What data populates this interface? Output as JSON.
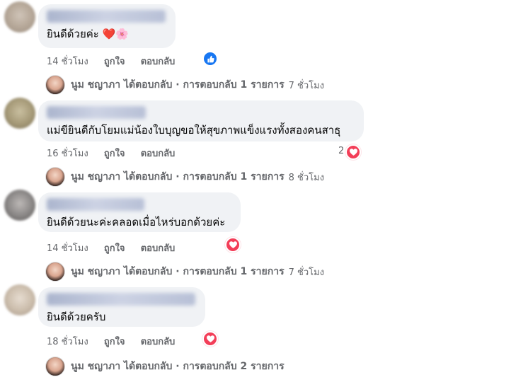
{
  "comments": [
    {
      "text": "ยินดีด้วยค่ะ ❤️🌸",
      "time": "14 ชั่วโมง",
      "like": "ถูกใจ",
      "reply": "ตอบกลับ",
      "reply_summary": {
        "name": "นูม ชญาภา",
        "text": "ได้ตอบกลับ · การตอบกลับ 1 รายการ",
        "time": "7 ชั่วโมง"
      }
    },
    {
      "text": "แม่ขียินดีกับโยมแม่น้องใบบุญขอให้สุขภาพแข็งแรงทั้งสองคนสาธุ",
      "time": "16 ชั่วโมง",
      "like": "ถูกใจ",
      "reply": "ตอบกลับ",
      "reaction_count": "2",
      "reply_summary": {
        "name": "นูม ชญาภา",
        "text": "ได้ตอบกลับ · การตอบกลับ 1 รายการ",
        "time": "8 ชั่วโมง"
      }
    },
    {
      "text": "ยินดีด้วยนะค่ะคลอดเมื่อไหร่บอกด้วยค่ะ",
      "time": "14 ชั่วโมง",
      "like": "ถูกใจ",
      "reply": "ตอบกลับ",
      "reply_summary": {
        "name": "นูม ชญาภา",
        "text": "ได้ตอบกลับ · การตอบกลับ 1 รายการ",
        "time": "7 ชั่วโมง"
      }
    },
    {
      "text": "ยินดีด้วยครับ",
      "time": "18 ชั่วโมง",
      "like": "ถูกใจ",
      "reply": "ตอบกลับ",
      "reply_summary": {
        "name": "นูม ชญาภา",
        "text": "ได้ตอบกลับ · การตอบกลับ 2 รายการ",
        "time": ""
      }
    }
  ],
  "colors": {
    "bubble": "#f0f2f5",
    "heart": "#f33e58",
    "like": "#1877f2",
    "meta": "#65676b"
  },
  "icons": [
    "like-icon",
    "heart-icon"
  ]
}
